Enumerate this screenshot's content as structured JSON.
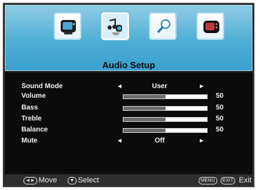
{
  "header": {
    "title": "Audio Setup",
    "tabs": [
      {
        "icon": "tv-picture-icon"
      },
      {
        "icon": "audio-music-icon",
        "selected": true
      },
      {
        "icon": "search-setup-icon"
      },
      {
        "icon": "tv-settings-icon"
      }
    ]
  },
  "menu": {
    "sound_mode": {
      "label": "Sound Mode",
      "value": "User",
      "left_arrow": "◄",
      "right_arrow": "►"
    },
    "volume": {
      "label": "Volume",
      "value": "50",
      "level": 0.5
    },
    "bass": {
      "label": "Bass",
      "value": "50",
      "level": 0.5
    },
    "treble": {
      "label": "Treble",
      "value": "50",
      "level": 0.5
    },
    "balance": {
      "label": "Balance",
      "value": "50",
      "level": 0.5
    },
    "mute": {
      "label": "Mute",
      "value": "Off",
      "left_arrow": "◄",
      "right_arrow": "►"
    }
  },
  "footer": {
    "move_label": "Move",
    "select_label": "Select",
    "exit_label": "Exit",
    "move_key": "◄►",
    "select_key": "▼",
    "menu_key": "MENU",
    "exit_key": "EXIT"
  },
  "colors": {
    "header_bg": "#4faed6",
    "menu_bg": "#0b0b0b",
    "bar_fill": "#6a6a6a",
    "bar_bg": "#ffffff"
  }
}
